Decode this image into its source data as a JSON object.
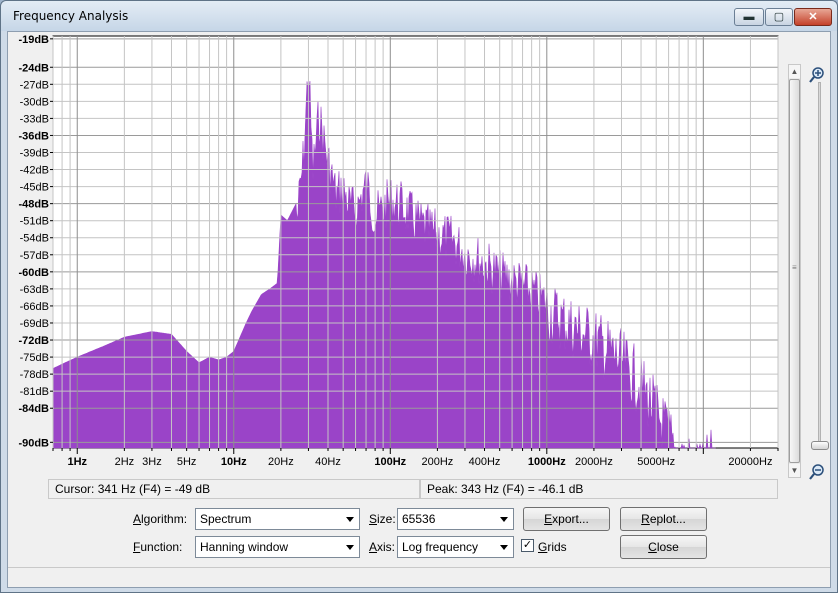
{
  "window": {
    "title": "Frequency Analysis"
  },
  "title_buttons": {
    "minimize": "▬",
    "maximize": "▢",
    "close": "✕"
  },
  "plot": {
    "y_labels": [
      {
        "text": "-19dB",
        "v": -19,
        "bold": true
      },
      {
        "text": "-24dB",
        "v": -24,
        "bold": true
      },
      {
        "text": "-27dB",
        "v": -27,
        "bold": false
      },
      {
        "text": "-30dB",
        "v": -30,
        "bold": false
      },
      {
        "text": "-33dB",
        "v": -33,
        "bold": false
      },
      {
        "text": "-36dB",
        "v": -36,
        "bold": true
      },
      {
        "text": "-39dB",
        "v": -39,
        "bold": false
      },
      {
        "text": "-42dB",
        "v": -42,
        "bold": false
      },
      {
        "text": "-45dB",
        "v": -45,
        "bold": false
      },
      {
        "text": "-48dB",
        "v": -48,
        "bold": true
      },
      {
        "text": "-51dB",
        "v": -51,
        "bold": false
      },
      {
        "text": "-54dB",
        "v": -54,
        "bold": false
      },
      {
        "text": "-57dB",
        "v": -57,
        "bold": false
      },
      {
        "text": "-60dB",
        "v": -60,
        "bold": true
      },
      {
        "text": "-63dB",
        "v": -63,
        "bold": false
      },
      {
        "text": "-66dB",
        "v": -66,
        "bold": false
      },
      {
        "text": "-69dB",
        "v": -69,
        "bold": false
      },
      {
        "text": "-72dB",
        "v": -72,
        "bold": true
      },
      {
        "text": "-75dB",
        "v": -75,
        "bold": false
      },
      {
        "text": "-78dB",
        "v": -78,
        "bold": false
      },
      {
        "text": "-81dB",
        "v": -81,
        "bold": false
      },
      {
        "text": "-84dB",
        "v": -84,
        "bold": true
      },
      {
        "text": "-90dB",
        "v": -90,
        "bold": true
      }
    ],
    "x_labels": [
      {
        "text": "1Hz",
        "f": 1,
        "bold": true
      },
      {
        "text": "2Hz",
        "f": 2,
        "bold": false
      },
      {
        "text": "3Hz",
        "f": 3,
        "bold": false
      },
      {
        "text": "5Hz",
        "f": 5,
        "bold": false
      },
      {
        "text": "10Hz",
        "f": 10,
        "bold": true
      },
      {
        "text": "20Hz",
        "f": 20,
        "bold": false
      },
      {
        "text": "40Hz",
        "f": 40,
        "bold": false
      },
      {
        "text": "100Hz",
        "f": 100,
        "bold": true
      },
      {
        "text": "200Hz",
        "f": 200,
        "bold": false
      },
      {
        "text": "400Hz",
        "f": 400,
        "bold": false
      },
      {
        "text": "1000Hz",
        "f": 1000,
        "bold": true
      },
      {
        "text": "2000Hz",
        "f": 2000,
        "bold": false
      },
      {
        "text": "5000Hz",
        "f": 5000,
        "bold": false
      },
      {
        "text": "20000Hz",
        "f": 20000,
        "bold": false
      }
    ]
  },
  "chart_data": {
    "type": "area",
    "xscale": "log",
    "xlabel": "",
    "ylabel": "",
    "xlim": [
      0.7,
      30000
    ],
    "ylim": [
      -91,
      -18.5
    ],
    "grid": true,
    "color": "#9a44c8",
    "x": [
      0.7,
      1,
      1.5,
      2,
      3,
      4,
      5,
      6,
      7,
      8,
      9,
      10,
      12,
      13,
      15,
      17,
      19,
      20,
      22,
      25,
      28,
      30,
      32,
      35,
      38,
      40,
      45,
      50,
      55,
      60,
      70,
      80,
      100,
      120,
      150,
      200,
      250,
      300,
      400,
      500,
      700,
      1000,
      1500,
      2000,
      3000,
      4000,
      5000,
      6000,
      7000,
      8000,
      10000,
      11000,
      12000
    ],
    "y": [
      -77,
      -75,
      -73,
      -71.5,
      -70.5,
      -71,
      -74,
      -76,
      -75,
      -75.5,
      -75,
      -74,
      -69,
      -67,
      -64,
      -63,
      -62,
      -50,
      -51,
      -48,
      -35,
      -19,
      -38,
      -28,
      -33,
      -36,
      -42,
      -41,
      -44,
      -45,
      -40,
      -46,
      -43,
      -44,
      -47,
      -49,
      -50,
      -52,
      -54,
      -56,
      -58,
      -61,
      -64,
      -66,
      -70,
      -74,
      -79,
      -83,
      -87,
      -88,
      -90,
      -87,
      -90
    ]
  },
  "info": {
    "cursor_label": "Cursor:",
    "cursor_value": "341 Hz (F4) = -49 dB",
    "peak_label": "Peak:",
    "peak_value": "343 Hz (F4) = -46.1 dB"
  },
  "controls": {
    "algorithm_label_u": "A",
    "algorithm_label_rest": "lgorithm:",
    "algorithm_value": "Spectrum",
    "size_label_u": "S",
    "size_label_rest": "ize:",
    "size_value": "65536",
    "function_label_u": "F",
    "function_label_rest": "unction:",
    "function_value": "Hanning window",
    "axis_label_u": "A",
    "axis_label_rest": "xis:",
    "axis_value": "Log frequency",
    "grids_checked": "✓",
    "grids_label_u": "G",
    "grids_label_rest": "rids",
    "export_label_u": "E",
    "export_label_rest": "xport...",
    "replot_label_u": "R",
    "replot_label_rest": "eplot...",
    "close_label_u": "C",
    "close_label_rest": "lose"
  }
}
